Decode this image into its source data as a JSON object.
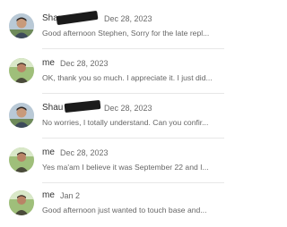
{
  "conversations": [
    {
      "name": "Shau",
      "date": "Dec 28, 2023",
      "preview": "Good afternoon Stephen, Sorry for the late repl...",
      "avatar": "avatar-photo-man-outdoors"
    },
    {
      "name": "me",
      "date": "Dec 28, 2023",
      "preview": "OK, thank you so much. I appreciate it. I just did...",
      "avatar": "avatar-photo-person-garden"
    },
    {
      "name": "Shau",
      "date": "Dec 28, 2023",
      "preview": "No worries, I totally understand. Can you confir...",
      "avatar": "avatar-photo-man-outdoors"
    },
    {
      "name": "me",
      "date": "Dec 28, 2023",
      "preview": "Yes ma'am I believe it was September 22 and I...",
      "avatar": "avatar-photo-person-garden"
    },
    {
      "name": "me",
      "date": "Jan 2",
      "preview": "Good afternoon just wanted to touch base and...",
      "avatar": "avatar-photo-person-garden"
    }
  ]
}
